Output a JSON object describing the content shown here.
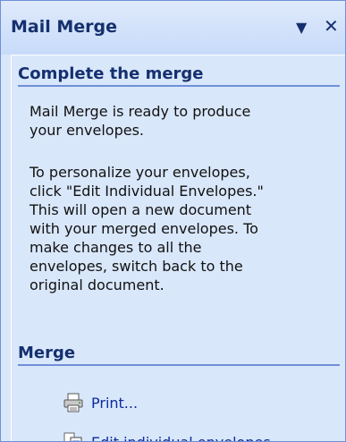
{
  "pane": {
    "title": "Mail Merge",
    "dropdown_icon": "▼",
    "close_icon": "✕"
  },
  "complete_section": {
    "header": "Complete the merge",
    "paragraph1_lines": [
      "Mail Merge is ready to produce",
      "your envelopes."
    ],
    "paragraph2_lines": [
      "To personalize your envelopes,",
      "click \"Edit Individual Envelopes.\"",
      "This will open a new document",
      "with your merged envelopes. To",
      "make changes to all the",
      "envelopes, switch back to the",
      "original document."
    ]
  },
  "merge_section": {
    "header": "Merge",
    "actions": [
      {
        "label": "Print...",
        "icon": "printer-icon"
      },
      {
        "label": "Edit individual envelopes...",
        "icon": "edit-document-icon"
      }
    ]
  }
}
